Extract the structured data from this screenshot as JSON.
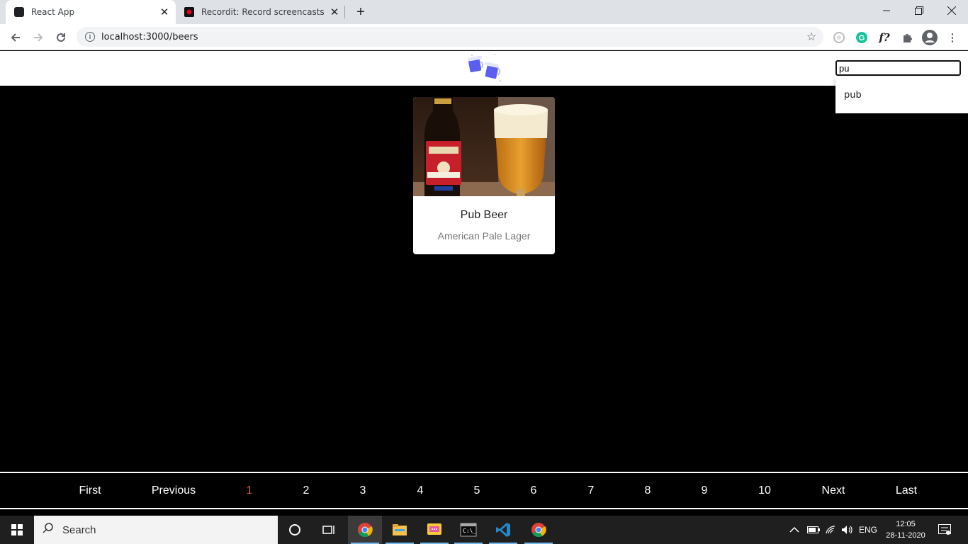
{
  "browser": {
    "tabs": [
      {
        "title": "React App",
        "active": true
      },
      {
        "title": "Recordit: Record screencasts fast",
        "active": false
      }
    ],
    "url": "localhost:3000/beers",
    "accent": "#dee1e6"
  },
  "header": {
    "search_value": "pu",
    "suggestions": [
      "pub"
    ]
  },
  "beer": {
    "name": "Pub Beer",
    "style": "American Pale Lager"
  },
  "pagination": {
    "first": "First",
    "previous": "Previous",
    "pages": [
      "1",
      "2",
      "3",
      "4",
      "5",
      "6",
      "7",
      "8",
      "9",
      "10"
    ],
    "current_page": "1",
    "next": "Next",
    "last": "Last",
    "current_color": "#d9534f"
  },
  "taskbar": {
    "search_placeholder": "Search",
    "language": "ENG",
    "time": "12:05",
    "date": "28-11-2020"
  }
}
